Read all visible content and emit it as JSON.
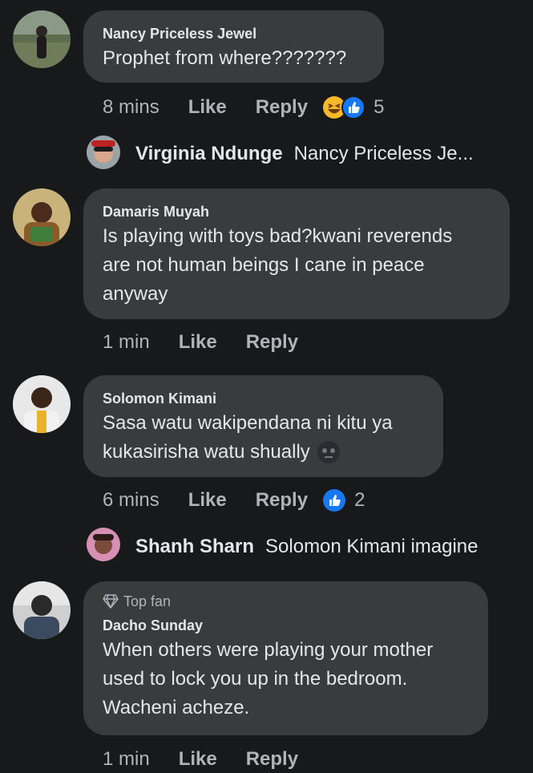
{
  "comments": [
    {
      "author": "Nancy Priceless Jewel",
      "text": "Prophet from where???????",
      "time": "8 mins",
      "like": "Like",
      "reply": "Reply",
      "reaction_count": "5",
      "reactions": [
        "haha-icon",
        "like-icon"
      ]
    },
    {
      "author": "Damaris Muyah",
      "text_lines": [
        "Is playing with toys bad?kwani reverends",
        "are not human beings I cane in peace",
        "anyway"
      ],
      "time": "1 min",
      "like": "Like",
      "reply": "Reply"
    },
    {
      "author": "Solomon Kimani",
      "text_lines": [
        "Sasa watu wakipendana ni kitu ya",
        "kukasirisha watu shually"
      ],
      "time": "6 mins",
      "like": "Like",
      "reply": "Reply",
      "reaction_count": "2",
      "reactions": [
        "like-icon"
      ]
    },
    {
      "badge": "Top fan",
      "author": "Dacho Sunday",
      "text_lines": [
        "When others were playing your mother",
        "used to lock you up in the bedroom.",
        "Wacheni acheze."
      ],
      "time": "1 min",
      "like": "Like",
      "reply": "Reply"
    }
  ],
  "replies": [
    {
      "name": "Virginia Ndunge",
      "text": "Nancy Priceless Je..."
    },
    {
      "name": "Shanh Sharn",
      "text": "Solomon Kimani imagine"
    }
  ],
  "colors": {
    "background": "#18191a",
    "bubble": "#3a3b3c",
    "text": "#e4e6eb",
    "secondary": "#b0b3b8",
    "like_blue": "#1877f2",
    "haha_yellow": "#f7b928"
  }
}
